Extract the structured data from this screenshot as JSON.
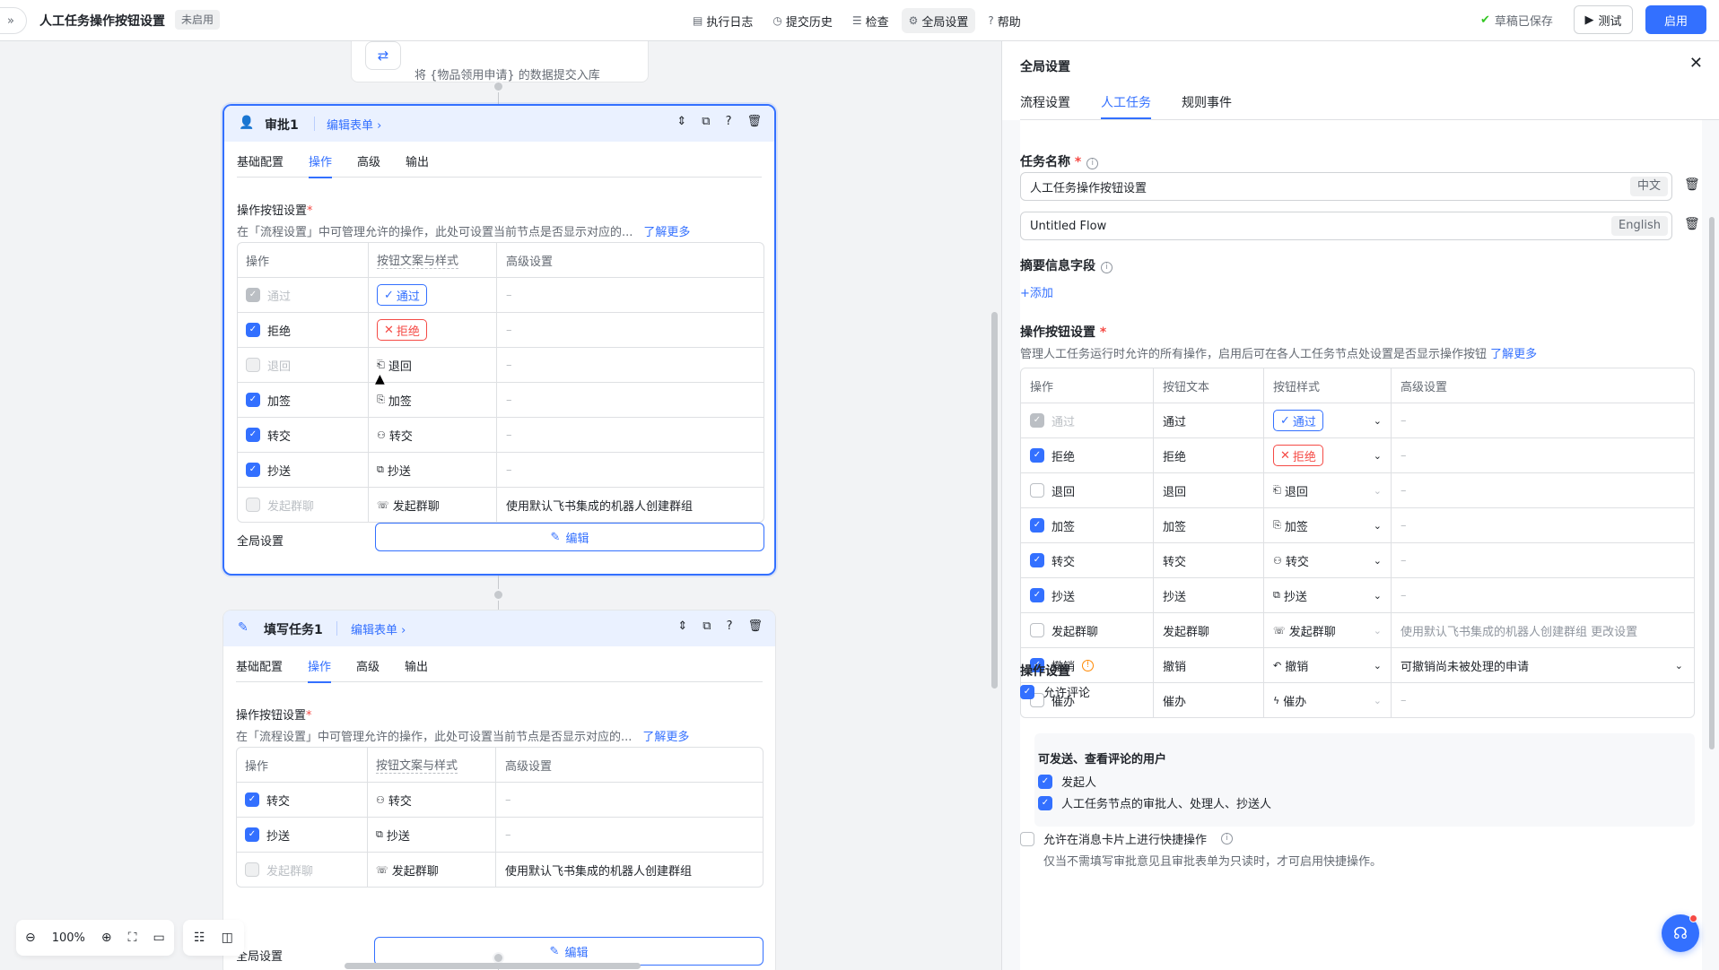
{
  "topbar": {
    "expand_icon": "double-chevron-right",
    "title": "人工任务操作按钮设置",
    "status": "未启用",
    "nav": [
      {
        "label": "执行日志",
        "icon": "log-icon"
      },
      {
        "label": "提交历史",
        "icon": "history-icon"
      },
      {
        "label": "检查",
        "icon": "check-icon"
      },
      {
        "label": "全局设置",
        "icon": "gear-icon"
      },
      {
        "label": "帮助",
        "icon": "help-icon"
      }
    ],
    "saved": "草稿已保存",
    "test": "测试",
    "start": "启用"
  },
  "canvas": {
    "prev_node_text": "将 {物品领用申请} 的数据提交入库",
    "node1": {
      "title": "审批1",
      "edit_form": "编辑表单",
      "tabs": [
        "基础配置",
        "操作",
        "高级",
        "输出"
      ],
      "active_tab": "操作",
      "section_label": "操作按钮设置",
      "section_desc": "在「流程设置」中可管理允许的操作，此处可设置当前节点是否显示对应的...",
      "learn_more": "了解更多",
      "headers": [
        "操作",
        "按钮文案与样式",
        "高级设置"
      ],
      "rows": [
        {
          "op": "通过",
          "state": "dison",
          "btn": "通过",
          "style": "pass",
          "adv": "–"
        },
        {
          "op": "拒绝",
          "state": "on",
          "btn": "拒绝",
          "style": "reject",
          "adv": "–"
        },
        {
          "op": "退回",
          "state": "dis",
          "btn": "退回",
          "style": "plain",
          "adv": "–"
        },
        {
          "op": "加签",
          "state": "on",
          "btn": "加签",
          "style": "plain",
          "adv": "–"
        },
        {
          "op": "转交",
          "state": "on",
          "btn": "转交",
          "style": "plain",
          "adv": "–"
        },
        {
          "op": "抄送",
          "state": "on",
          "btn": "抄送",
          "style": "plain",
          "adv": "–"
        },
        {
          "op": "发起群聊",
          "state": "dis",
          "btn": "发起群聊",
          "style": "plain",
          "adv": "使用默认飞书集成的机器人创建群组"
        }
      ],
      "global_label": "全局设置",
      "edit_btn": "编辑"
    },
    "node2": {
      "title": "填写任务1",
      "edit_form": "编辑表单",
      "tabs": [
        "基础配置",
        "操作",
        "高级",
        "输出"
      ],
      "active_tab": "操作",
      "section_label": "操作按钮设置",
      "section_desc": "在「流程设置」中可管理允许的操作，此处可设置当前节点是否显示对应的...",
      "learn_more": "了解更多",
      "headers": [
        "操作",
        "按钮文案与样式",
        "高级设置"
      ],
      "rows": [
        {
          "op": "转交",
          "state": "on",
          "btn": "转交",
          "style": "plain",
          "adv": "–"
        },
        {
          "op": "抄送",
          "state": "on",
          "btn": "抄送",
          "style": "plain",
          "adv": "–"
        },
        {
          "op": "发起群聊",
          "state": "dis",
          "btn": "发起群聊",
          "style": "plain",
          "adv": "使用默认飞书集成的机器人创建群组"
        }
      ],
      "global_label": "全局设置",
      "edit_btn": "编辑"
    },
    "zoom": "100%"
  },
  "panel": {
    "title": "全局设置",
    "tabs": [
      "流程设置",
      "人工任务",
      "规则事件"
    ],
    "active_tab": "人工任务",
    "task_name_label": "任务名称",
    "task_name_zh": "人工任务操作按钮设置",
    "lang_zh": "中文",
    "task_name_en": "Untitled Flow",
    "lang_en": "English",
    "summary_label": "摘要信息字段",
    "add": "添加",
    "ops_label": "操作按钮设置",
    "ops_desc": "管理人工任务运行时允许的所有操作，启用后可在各人工任务节点处设置是否显示操作按钮",
    "learn_more": "了解更多",
    "headers": [
      "操作",
      "按钮文本",
      "按钮样式",
      "高级设置"
    ],
    "rows": [
      {
        "op": "通过",
        "state": "dison",
        "text": "通过",
        "btn": "通过",
        "style": "pass",
        "adv": "–",
        "adv_type": "dash"
      },
      {
        "op": "拒绝",
        "state": "on",
        "text": "拒绝",
        "btn": "拒绝",
        "style": "reject",
        "adv": "–",
        "adv_type": "dash"
      },
      {
        "op": "退回",
        "state": "off",
        "text": "退回",
        "btn": "退回",
        "style": "plain",
        "adv": "–",
        "adv_type": "dash"
      },
      {
        "op": "加签",
        "state": "on",
        "text": "加签",
        "btn": "加签",
        "style": "plain",
        "adv": "–",
        "adv_type": "dash"
      },
      {
        "op": "转交",
        "state": "on",
        "text": "转交",
        "btn": "转交",
        "style": "plain",
        "adv": "–",
        "adv_type": "dash"
      },
      {
        "op": "抄送",
        "state": "on",
        "text": "抄送",
        "btn": "抄送",
        "style": "plain",
        "adv": "–",
        "adv_type": "dash"
      },
      {
        "op": "发起群聊",
        "state": "off",
        "text": "发起群聊",
        "btn": "发起群聊",
        "style": "plain",
        "adv": "使用默认飞书集成的机器人创建群组  更改设置",
        "adv_type": "gray"
      },
      {
        "op": "撤销",
        "state": "on",
        "text": "撤销",
        "btn": "撤销",
        "style": "plain",
        "adv": "可撤销尚未被处理的申请",
        "adv_type": "select"
      },
      {
        "op": "催办",
        "state": "off",
        "text": "催办",
        "btn": "催办",
        "style": "plain",
        "adv": "–",
        "adv_type": "dash"
      }
    ],
    "op_settings_label": "操作设置",
    "allow_comment": "允许评论",
    "comment_users_label": "可发送、查看评论的用户",
    "user_initiator": "发起人",
    "user_handlers": "人工任务节点的审批人、处理人、抄送人",
    "quick_action": "允许在消息卡片上进行快捷操作",
    "quick_hint": "仅当不需填写审批意见且审批表单为只读时，才可启用快捷操作。"
  }
}
